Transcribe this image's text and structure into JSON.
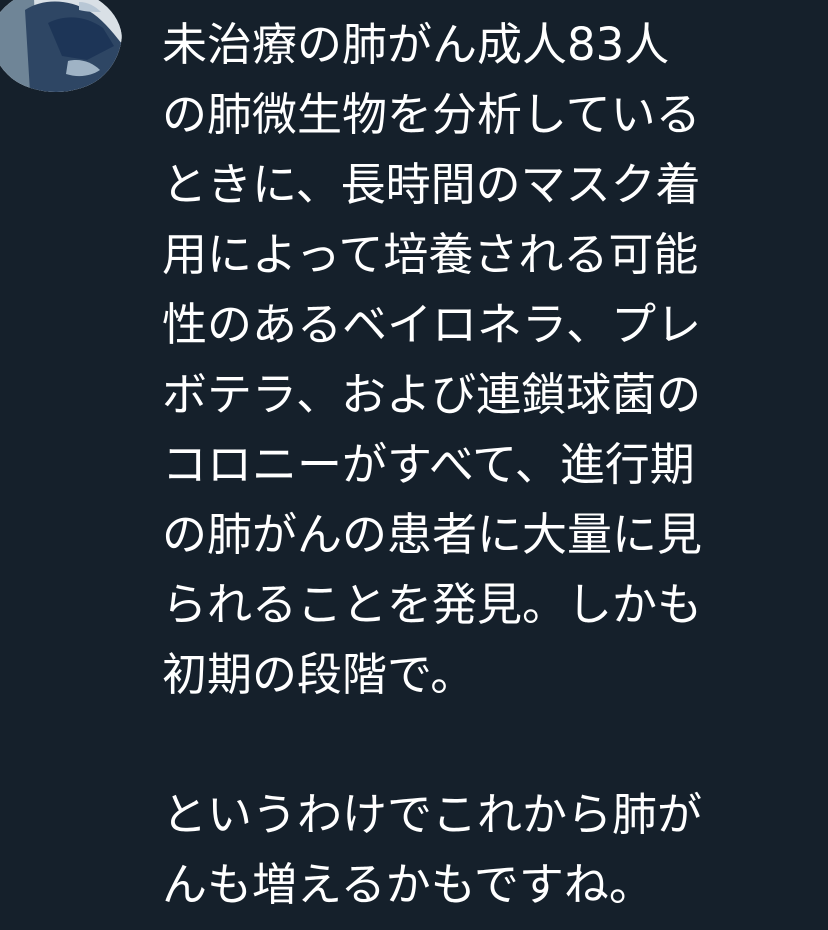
{
  "tweet": {
    "text_lines": [
      "未治療の肺がん成人83人",
      "の肺微生物を分析している",
      "ときに、長時間のマスク着",
      "用によって培養される可能",
      "性のあるベイロネラ、プレ",
      "ボテラ、および連鎖球菌の",
      "コロニーがすべて、進行期",
      "の肺がんの患者に大量に見",
      "られることを発見。しかも",
      "初期の段階で。",
      "",
      "というわけでこれから肺が",
      "んも増えるかもですね。"
    ]
  },
  "colors": {
    "background": "#15202b",
    "text": "#ffffff"
  }
}
